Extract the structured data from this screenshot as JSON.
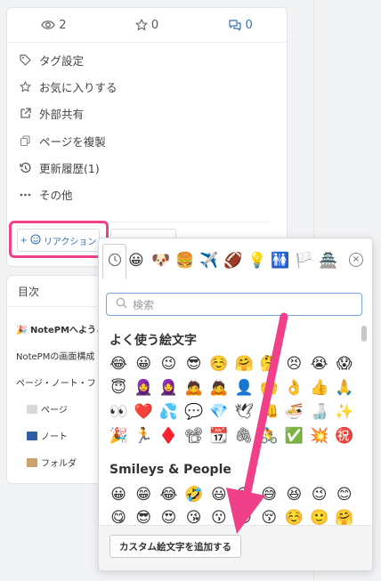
{
  "stats": {
    "views": "2",
    "stars": "0",
    "comments": "0"
  },
  "menu": [
    {
      "icon": "tag-icon",
      "label": "タグ設定"
    },
    {
      "icon": "star-icon",
      "label": "お気に入りする"
    },
    {
      "icon": "external-share-icon",
      "label": "外部共有"
    },
    {
      "icon": "copy-icon",
      "label": "ページを複製"
    },
    {
      "icon": "history-icon",
      "label": "更新履歴(1)"
    },
    {
      "icon": "more-icon",
      "label": "その他"
    }
  ],
  "reaction_button": {
    "plus": "+",
    "label": "リアクション"
  },
  "toc": {
    "title": "目次",
    "items": [
      "NotePMへようこ",
      "NotePMの画面構成",
      "ページ・ノート・フ"
    ],
    "subitems": [
      {
        "label": "ページ",
        "color": "#d9d9d9"
      },
      {
        "label": "ノート",
        "color": "#2f5fa7"
      },
      {
        "label": "フォルダ",
        "color": "#c9a36b"
      }
    ],
    "party_emoji": "🎉"
  },
  "picker": {
    "categories": [
      "😀",
      "🐶",
      "🍔",
      "✈️",
      "🏈",
      "💡",
      "🚻",
      "🏳️",
      "🏯"
    ],
    "search_placeholder": "検索",
    "frequent_title": "よく使う絵文字",
    "frequent_rows": [
      [
        "😂",
        "😀",
        "😉",
        "😎",
        "☺️",
        "🤗",
        "🤔",
        "😣",
        "😭",
        "😱"
      ],
      [
        "😇",
        "🧕",
        "🧕",
        "🙇",
        "🙇",
        "👤",
        "🙌",
        "👌",
        "👍",
        "🙏"
      ],
      [
        "👀",
        "❤️",
        "💦",
        "💬",
        "💎",
        "🕊",
        "👊",
        "🍜",
        "🍶",
        "✨"
      ],
      [
        "🎉",
        "🏃",
        "♦️",
        "📽",
        "📆",
        "🖇",
        "🚴",
        "✅",
        "💥",
        "㊗️"
      ]
    ],
    "smileys_title": "Smileys & People",
    "smileys_rows": [
      [
        "😀",
        "😁",
        "😂",
        "🤣",
        "😃",
        "😄",
        "😅",
        "😆",
        "😉",
        "😊"
      ],
      [
        "😋",
        "😎",
        "😍",
        "😘",
        "😗",
        "😙",
        "😚",
        "☺️",
        "🙂",
        "🤗"
      ]
    ],
    "add_button": "カスタム絵文字を追加する"
  },
  "colors": {
    "accent": "#3572b0",
    "highlight": "#f0408a"
  }
}
